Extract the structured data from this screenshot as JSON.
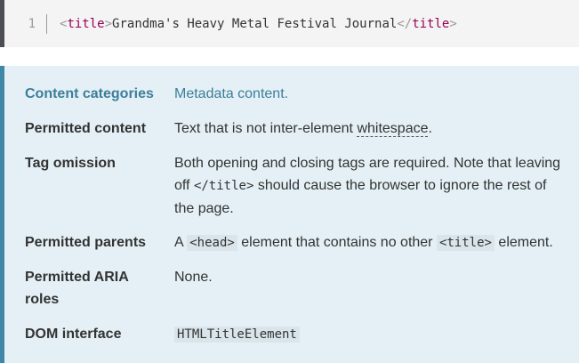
{
  "code": {
    "line_number": "1",
    "open_lt": "<",
    "open_tag": "title",
    "open_gt": ">",
    "content": "Grandma's Heavy Metal Festival Journal",
    "close_lt": "</",
    "close_tag": "title",
    "close_gt": ">"
  },
  "properties": [
    {
      "label": "Content categories",
      "value": "Metadata content."
    },
    {
      "label": "Permitted content",
      "value_before": "Text that is not inter-element ",
      "value_link": "whitespace",
      "value_after": "."
    },
    {
      "label": "Tag omission",
      "value_before": "Both opening and closing tags are required. Note that leaving off ",
      "value_code": "</title>",
      "value_after": " should cause the browser to ignore the rest of the page."
    },
    {
      "label": "Permitted parents",
      "value_a": "A ",
      "value_code1": "<head>",
      "value_b": " element that contains no other ",
      "value_code2": "<title>",
      "value_c": " element."
    },
    {
      "label": "Permitted ARIA roles",
      "value": "None."
    },
    {
      "label": "DOM interface",
      "value_code": "HTMLTitleElement"
    }
  ],
  "colors": {
    "code_bg": "#f4f4f4",
    "props_bg": "#e4f0f5",
    "accent": "#3f87a6",
    "link": "#3d7e9a",
    "tag": "#990055"
  }
}
